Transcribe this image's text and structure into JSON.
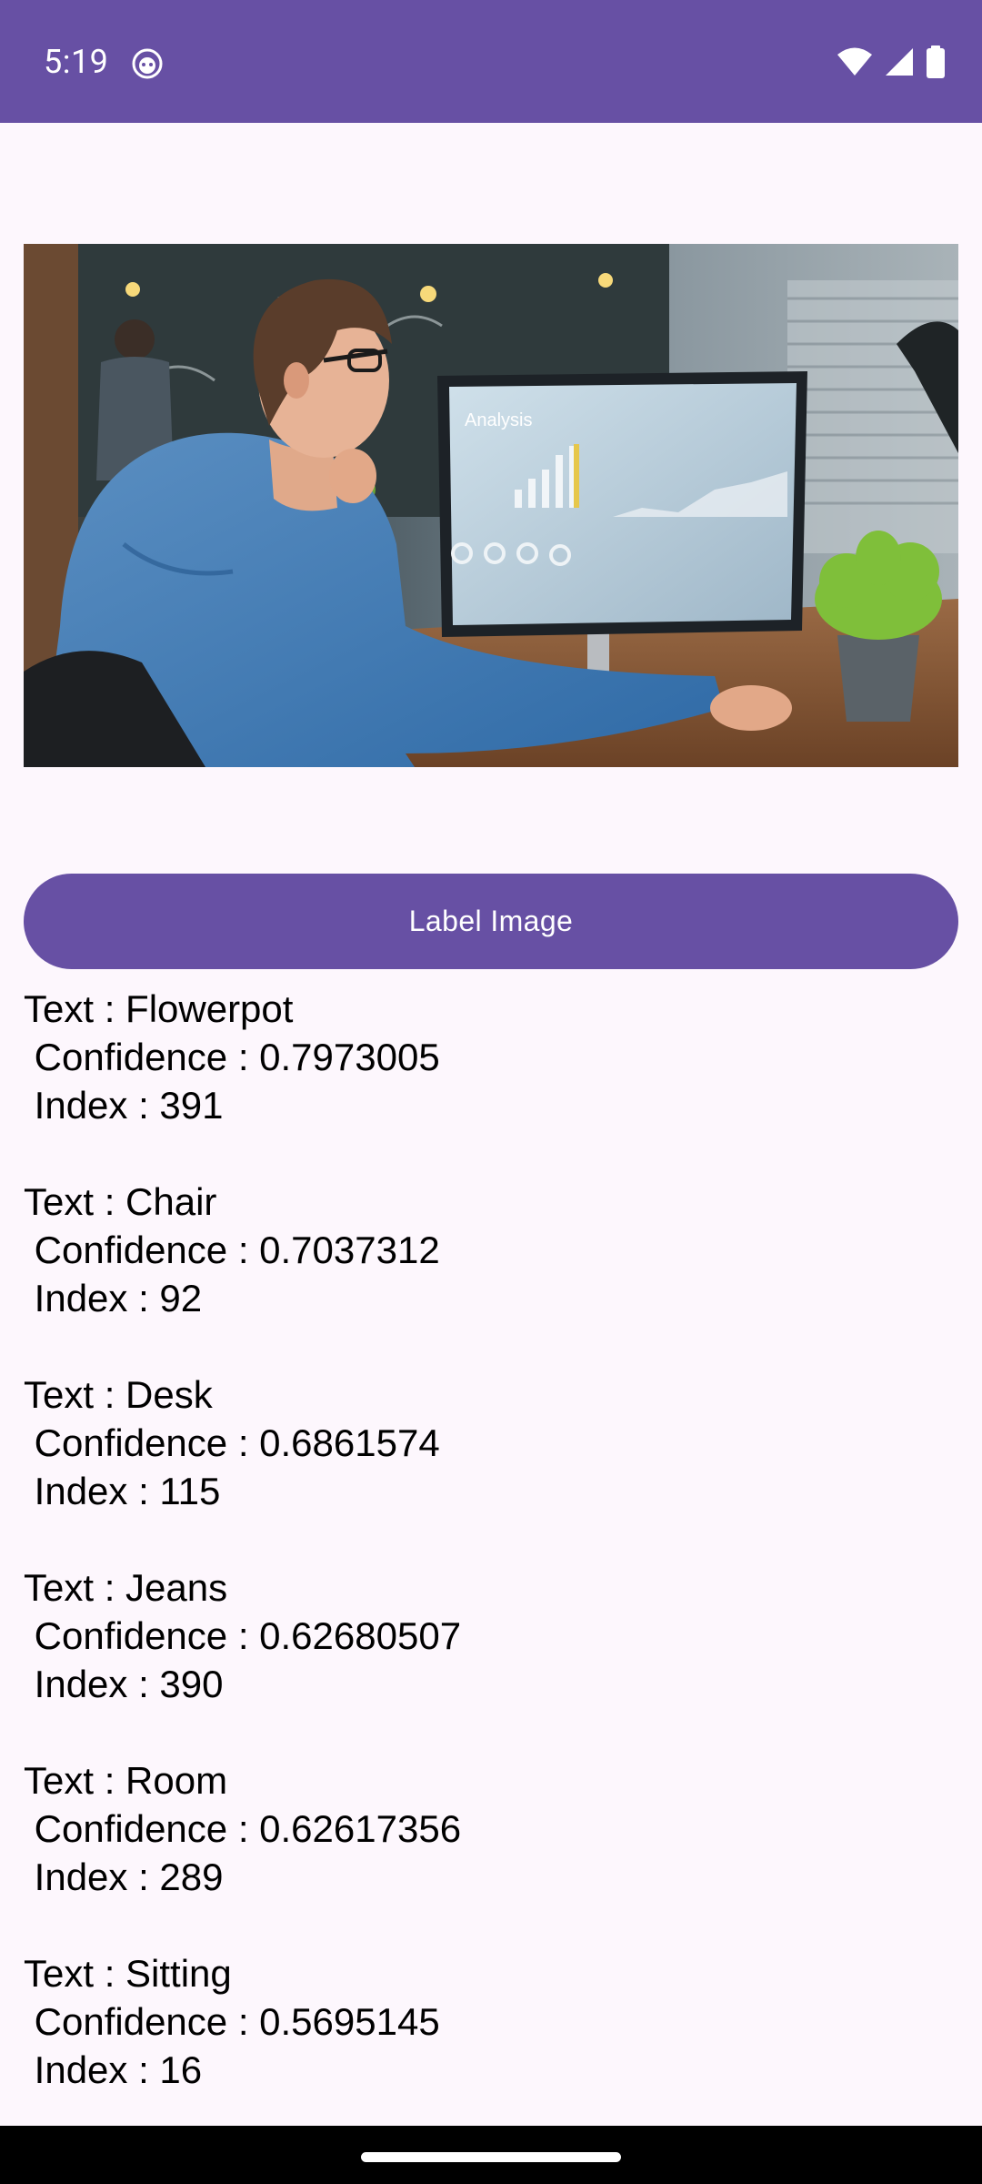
{
  "status_bar": {
    "time": "5:19",
    "icons": [
      "face-notification-icon",
      "wifi-icon",
      "signal-icon",
      "battery-icon"
    ]
  },
  "image": {
    "description_icon": "photo-of-man-at-computer"
  },
  "button": {
    "label": "Label Image"
  },
  "results": [
    {
      "text": "Text : Flowerpot",
      "confidence": " Confidence : 0.7973005",
      "index": " Index : 391"
    },
    {
      "text": "Text : Chair",
      "confidence": " Confidence : 0.7037312",
      "index": " Index : 92"
    },
    {
      "text": "Text : Desk",
      "confidence": " Confidence : 0.6861574",
      "index": " Index : 115"
    },
    {
      "text": "Text : Jeans",
      "confidence": " Confidence : 0.62680507",
      "index": " Index : 390"
    },
    {
      "text": "Text : Room",
      "confidence": " Confidence : 0.62617356",
      "index": " Index : 289"
    },
    {
      "text": "Text : Sitting",
      "confidence": " Confidence : 0.5695145",
      "index": " Index : 16"
    }
  ],
  "colors": {
    "primary": "#6750a4",
    "background": "#fdf7fd",
    "on_primary": "#ffffff"
  }
}
